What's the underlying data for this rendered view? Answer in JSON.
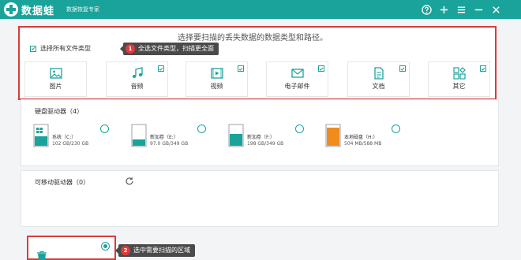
{
  "app": {
    "name": "数据蛙",
    "tagline": "数据恢复专家",
    "brand_color": "#1aa39a"
  },
  "titlebar": {
    "buttons": [
      {
        "icon": "help-icon"
      },
      {
        "icon": "plus-icon"
      },
      {
        "icon": "menu-icon"
      },
      {
        "icon": "minimize-icon"
      },
      {
        "icon": "close-icon"
      }
    ]
  },
  "file_types": {
    "instruction": "选择要扫描的丢失数据的数据类型和路径。",
    "select_all_label": "选择所有文件类型",
    "select_all_checked": true,
    "items": [
      {
        "label": "图片",
        "icon": "image-icon",
        "checked": true
      },
      {
        "label": "音频",
        "icon": "audio-icon",
        "checked": true
      },
      {
        "label": "视频",
        "icon": "video-icon",
        "checked": true
      },
      {
        "label": "电子邮件",
        "icon": "email-icon",
        "checked": true
      },
      {
        "label": "文档",
        "icon": "document-icon",
        "checked": true
      },
      {
        "label": "其它",
        "icon": "other-icon",
        "checked": true
      }
    ]
  },
  "tooltips": {
    "step1": {
      "number": "1",
      "text": "全选文件类型，扫描更全面"
    },
    "step2": {
      "number": "2",
      "text": "选中需要扫描的区域"
    }
  },
  "hard_drives": {
    "title": "硬盘驱动器（4）",
    "drives": [
      {
        "name": "系统（C:）",
        "size": "102 GB/230 GB",
        "used_fraction": 0.44,
        "color": "#1aa39a",
        "selected": false
      },
      {
        "name": "新加卷（E:）",
        "size": "97.0 GB/349 GB",
        "used_fraction": 0.28,
        "color": "#1aa39a",
        "selected": false
      },
      {
        "name": "新加卷（F:）",
        "size": "198 GB/349 GB",
        "used_fraction": 0.57,
        "color": "#1aa39a",
        "selected": false
      },
      {
        "name": "本地磁盘（H:）",
        "size": "504 MB/588 MB",
        "used_fraction": 0.86,
        "color": "#f08c1e",
        "selected": false
      }
    ]
  },
  "removable_drives": {
    "title": "可移动驱动器（0）"
  },
  "recycle_bin": {
    "icon": "recycle-bin-icon",
    "selected": true
  }
}
